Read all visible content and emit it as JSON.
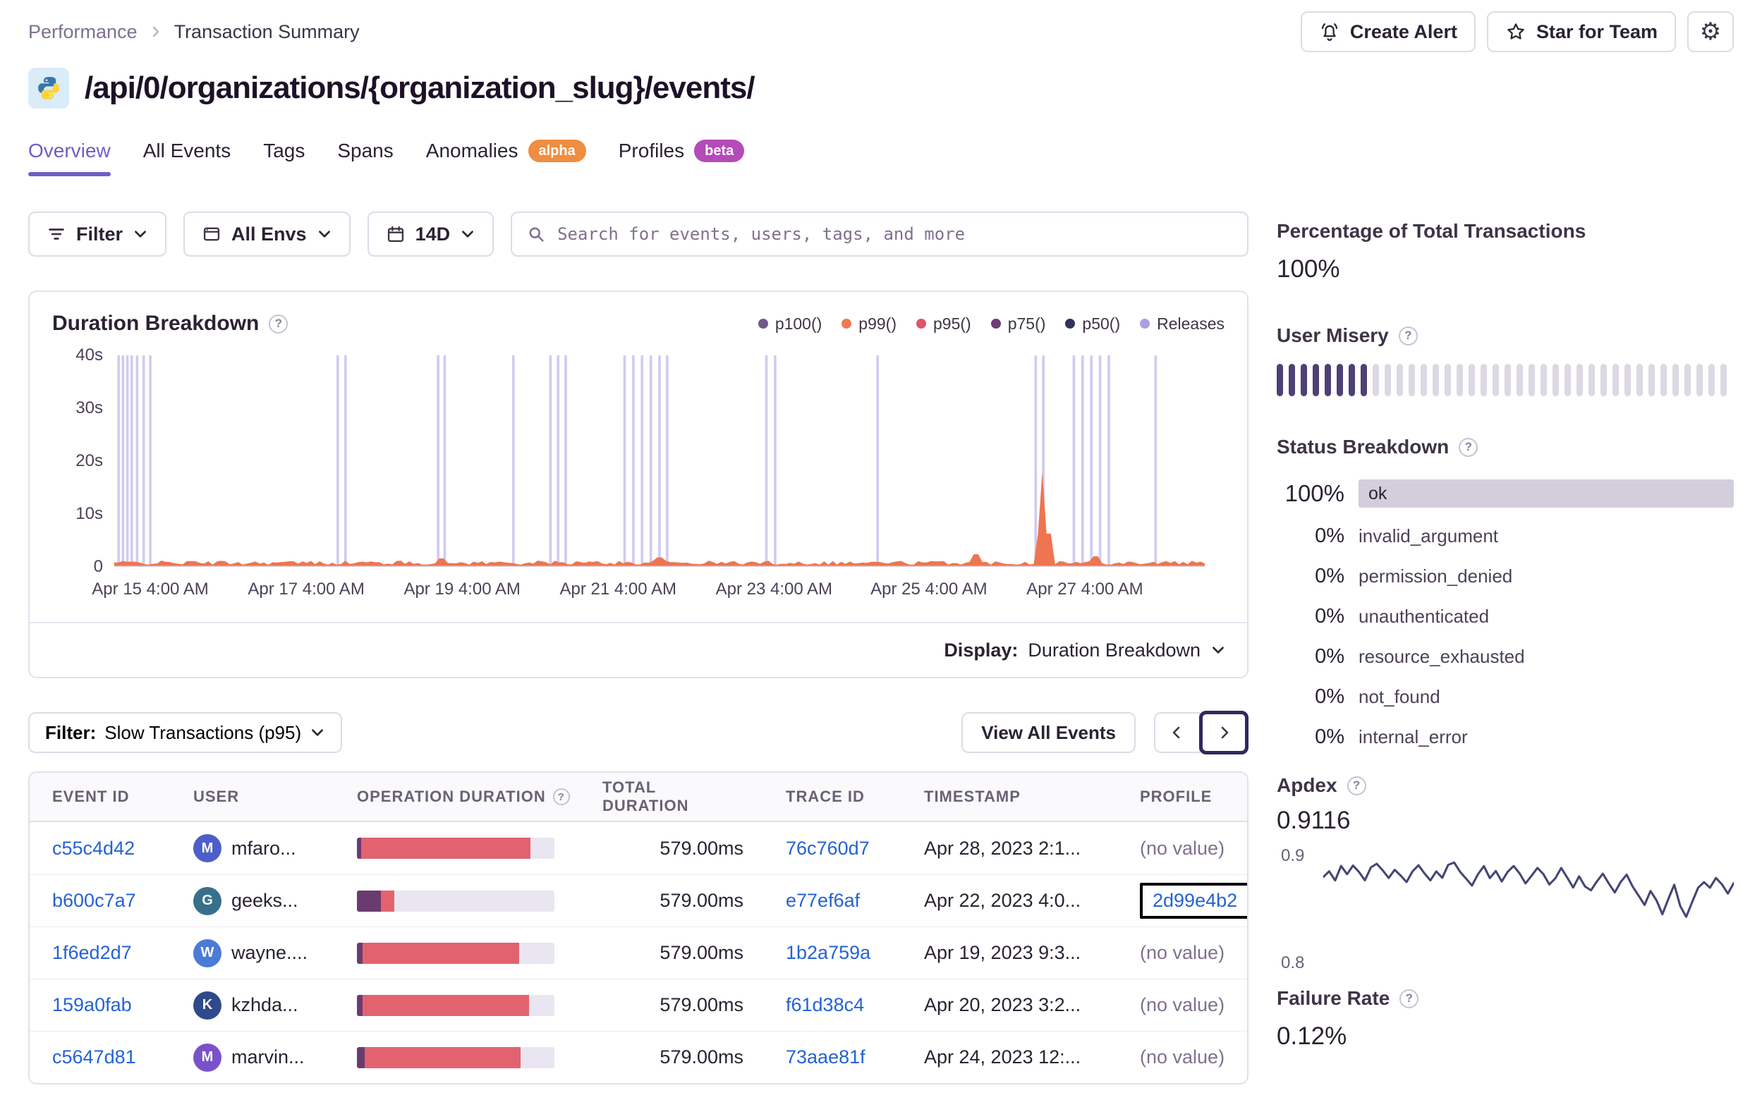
{
  "breadcrumb": {
    "parent": "Performance",
    "current": "Transaction Summary"
  },
  "header": {
    "create_alert": "Create Alert",
    "star_for_team": "Star for Team",
    "title": "/api/0/organizations/{organization_slug}/events/"
  },
  "icons": {
    "gear": "⚙"
  },
  "tabs": [
    {
      "label": "Overview",
      "active": true
    },
    {
      "label": "All Events"
    },
    {
      "label": "Tags"
    },
    {
      "label": "Spans"
    },
    {
      "label": "Anomalies",
      "badge": "alpha"
    },
    {
      "label": "Profiles",
      "badge": "beta"
    }
  ],
  "filters": {
    "filter_label": "Filter",
    "envs_label": "All Envs",
    "date_label": "14D",
    "search_placeholder": "Search for events, users, tags, and more"
  },
  "chart": {
    "title": "Duration Breakdown",
    "legend": [
      {
        "label": "p100()",
        "color": "#6d5a8f"
      },
      {
        "label": "p99()",
        "color": "#ef7a50"
      },
      {
        "label": "p95()",
        "color": "#e2536c"
      },
      {
        "label": "p75()",
        "color": "#6f3c74"
      },
      {
        "label": "p50()",
        "color": "#32325e"
      },
      {
        "label": "Releases",
        "color": "#aba0e6"
      }
    ],
    "y_ticks": [
      "40s",
      "30s",
      "20s",
      "10s",
      "0"
    ],
    "x_ticks": [
      {
        "label": "Apr 15 4:00 AM",
        "x": 0.033
      },
      {
        "label": "Apr 17 4:00 AM",
        "x": 0.176
      },
      {
        "label": "Apr 19 4:00 AM",
        "x": 0.319
      },
      {
        "label": "Apr 21 4:00 AM",
        "x": 0.462
      },
      {
        "label": "Apr 23 4:00 AM",
        "x": 0.605
      },
      {
        "label": "Apr 25 4:00 AM",
        "x": 0.747
      },
      {
        "label": "Apr 27 4:00 AM",
        "x": 0.89
      }
    ],
    "releases": [
      0.004,
      0.008,
      0.012,
      0.016,
      0.021,
      0.027,
      0.033,
      0.205,
      0.212,
      0.297,
      0.303,
      0.366,
      0.4,
      0.407,
      0.414,
      0.468,
      0.476,
      0.484,
      0.492,
      0.5,
      0.507,
      0.598,
      0.606,
      0.7,
      0.845,
      0.852,
      0.88,
      0.888,
      0.896,
      0.904,
      0.912,
      0.955
    ],
    "spikes": [
      {
        "x": 0.3,
        "h": 0.04
      },
      {
        "x": 0.5,
        "h": 0.045
      },
      {
        "x": 0.79,
        "h": 0.06
      },
      {
        "x": 0.852,
        "h": 0.45
      },
      {
        "x": 0.9,
        "h": 0.05
      }
    ],
    "colors": {
      "releases": "#a9a0e2",
      "area": "#ee7550"
    },
    "display_label": "Display:",
    "display_value": "Duration Breakdown"
  },
  "table_controls": {
    "filter_label": "Filter:",
    "filter_value": "Slow Transactions (p95)",
    "view_all": "View All Events"
  },
  "table": {
    "headers": [
      "EVENT ID",
      "USER",
      "OPERATION DURATION",
      "TOTAL DURATION",
      "TRACE ID",
      "TIMESTAMP",
      "PROFILE"
    ],
    "rows": [
      {
        "event_id": "c55c4d42",
        "user": "mfaro...",
        "avatar": "M",
        "avatar_color": "#4e5ec9",
        "segments": [
          {
            "color": "#6a3b70",
            "pct": 2
          },
          {
            "color": "#e2636f",
            "pct": 86
          }
        ],
        "total": "579.00ms",
        "trace": "76c760d7",
        "timestamp": "Apr 28, 2023 2:1...",
        "profile": "(no value)"
      },
      {
        "event_id": "b600c7a7",
        "user": "geeks...",
        "avatar": "G",
        "avatar_color": "#38708c",
        "segments": [
          {
            "color": "#6a3b70",
            "pct": 12
          },
          {
            "color": "#e2636f",
            "pct": 7
          }
        ],
        "total": "579.00ms",
        "trace": "e77ef6af",
        "timestamp": "Apr 22, 2023 4:0...",
        "profile_link": "2d99e4b2",
        "focused": true
      },
      {
        "event_id": "1f6ed2d7",
        "user": "wayne....",
        "avatar": "W",
        "avatar_color": "#4b7bd6",
        "segments": [
          {
            "color": "#6a3b70",
            "pct": 3
          },
          {
            "color": "#e2636f",
            "pct": 79
          }
        ],
        "total": "579.00ms",
        "trace": "1b2a759a",
        "timestamp": "Apr 19, 2023 9:3...",
        "profile": "(no value)"
      },
      {
        "event_id": "159a0fab",
        "user": "kzhda...",
        "avatar": "K",
        "avatar_color": "#2f4a8a",
        "segments": [
          {
            "color": "#6a3b70",
            "pct": 3
          },
          {
            "color": "#e2636f",
            "pct": 84
          }
        ],
        "total": "579.00ms",
        "trace": "f61d38c4",
        "timestamp": "Apr 20, 2023 3:2...",
        "profile": "(no value)"
      },
      {
        "event_id": "c5647d81",
        "user": "marvin...",
        "avatar": "M",
        "avatar_color": "#7952c9",
        "segments": [
          {
            "color": "#6a3b70",
            "pct": 4
          },
          {
            "color": "#e2636f",
            "pct": 79
          }
        ],
        "total": "579.00ms",
        "trace": "73aae81f",
        "timestamp": "Apr 24, 2023 12:...",
        "profile": "(no value)"
      }
    ]
  },
  "sidebar": {
    "pct_total": {
      "label": "Percentage of Total Transactions",
      "value": "100%"
    },
    "user_misery": {
      "label": "User Misery",
      "total_bars": 38,
      "dark_bars": 8
    },
    "status_breakdown": {
      "label": "Status Breakdown",
      "items": [
        {
          "pct": "100%",
          "name": "ok",
          "bar": true
        },
        {
          "pct": "0%",
          "name": "invalid_argument"
        },
        {
          "pct": "0%",
          "name": "permission_denied"
        },
        {
          "pct": "0%",
          "name": "unauthenticated"
        },
        {
          "pct": "0%",
          "name": "resource_exhausted"
        },
        {
          "pct": "0%",
          "name": "not_found"
        },
        {
          "pct": "0%",
          "name": "internal_error"
        }
      ]
    },
    "apdex": {
      "label": "Apdex",
      "value": "0.9116",
      "y_top": "0.9",
      "y_bottom": "0.8",
      "line_color": "#444674",
      "points": [
        0.878,
        0.884,
        0.876,
        0.887,
        0.879,
        0.889,
        0.882,
        0.874,
        0.886,
        0.891,
        0.883,
        0.876,
        0.885,
        0.879,
        0.872,
        0.883,
        0.889,
        0.88,
        0.875,
        0.884,
        0.878,
        0.888,
        0.893,
        0.884,
        0.877,
        0.87,
        0.88,
        0.887,
        0.878,
        0.884,
        0.875,
        0.882,
        0.889,
        0.881,
        0.873,
        0.88,
        0.887,
        0.879,
        0.871,
        0.878,
        0.885,
        0.876,
        0.868,
        0.877,
        0.87,
        0.864,
        0.874,
        0.881,
        0.872,
        0.863,
        0.872,
        0.879,
        0.869,
        0.86,
        0.851,
        0.865,
        0.856,
        0.843,
        0.858,
        0.869,
        0.851,
        0.838,
        0.855,
        0.866,
        0.874,
        0.867,
        0.876,
        0.869,
        0.861,
        0.872
      ]
    },
    "failure_rate": {
      "label": "Failure Rate",
      "value": "0.12%"
    }
  }
}
